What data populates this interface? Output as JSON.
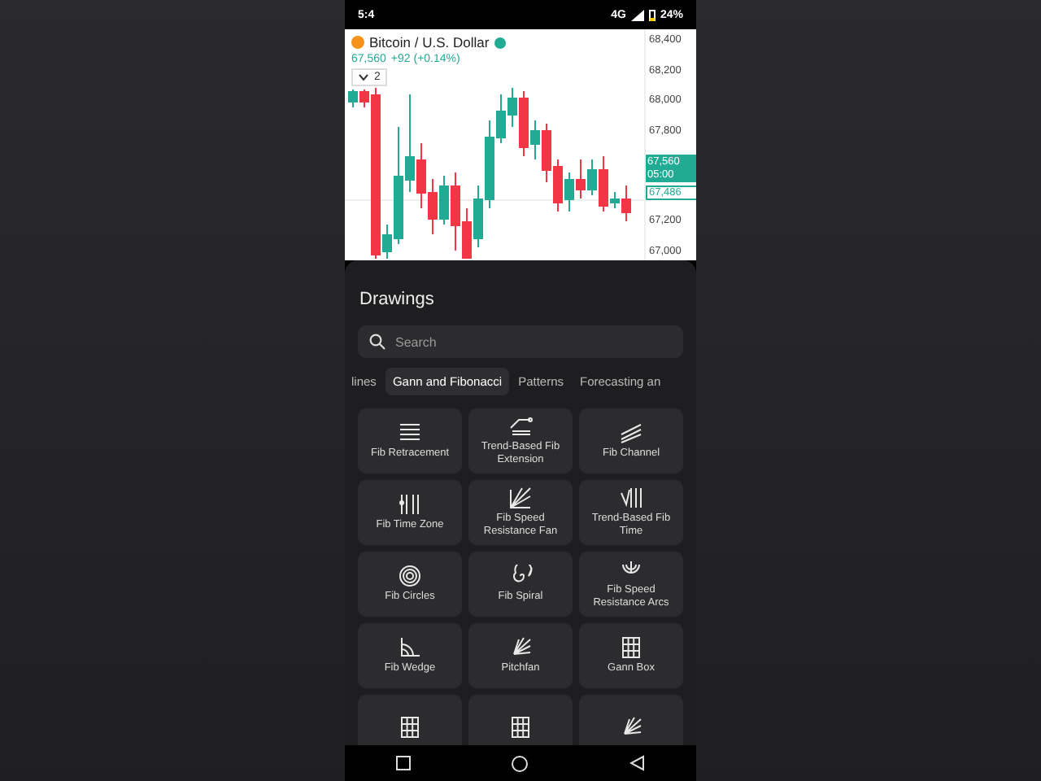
{
  "status_bar": {
    "time": "5:4",
    "network": "4G",
    "battery": "24%"
  },
  "chart": {
    "symbol": "Bitcoin / U.S. Dollar",
    "live": true,
    "price": "67,560",
    "change": "+92 (+0.14%)",
    "collapse_count": "2",
    "price_axis": [
      "68,400",
      "68,200",
      "68,000",
      "67,800",
      "67,200",
      "67,000"
    ],
    "last_price": "67,560",
    "countdown": "05:00",
    "marker_price": "67,486"
  },
  "sheet": {
    "title": "Drawings",
    "search": {
      "placeholder": "Search"
    },
    "tabs": [
      {
        "label": "lines",
        "selected": false
      },
      {
        "label": "Gann and Fibonacci",
        "selected": true
      },
      {
        "label": "Patterns",
        "selected": false
      },
      {
        "label": "Forecasting an",
        "selected": false
      }
    ],
    "tools": [
      {
        "kind": "retracement",
        "label": "Fib Retracement"
      },
      {
        "kind": "extension",
        "label": "Trend-Based Fib Extension"
      },
      {
        "kind": "channel",
        "label": "Fib Channel"
      },
      {
        "kind": "timezone",
        "label": "Fib Time Zone"
      },
      {
        "kind": "speedfan",
        "label": "Fib Speed Resistance Fan"
      },
      {
        "kind": "trendtime",
        "label": "Trend-Based Fib Time"
      },
      {
        "kind": "circles",
        "label": "Fib Circles"
      },
      {
        "kind": "spiral",
        "label": "Fib Spiral"
      },
      {
        "kind": "arcs",
        "label": "Fib Speed Resistance Arcs"
      },
      {
        "kind": "wedge",
        "label": "Fib Wedge"
      },
      {
        "kind": "pitchfan",
        "label": "Pitchfan"
      },
      {
        "kind": "box",
        "label": "Gann Box"
      },
      {
        "kind": "square"
      },
      {
        "kind": "square"
      },
      {
        "kind": "pitchfan"
      }
    ]
  }
}
